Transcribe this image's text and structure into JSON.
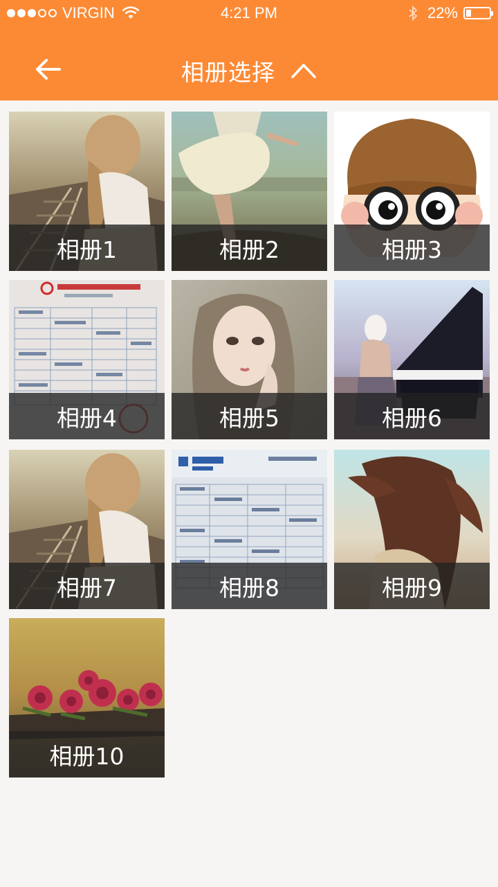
{
  "status_bar": {
    "carrier": "VIRGIN",
    "time": "4:21 PM",
    "battery_percent": "22%",
    "battery_level": 0.22,
    "signal_bars_filled": 3,
    "signal_bars_total": 5,
    "icons": [
      "signal-dots",
      "wifi-icon",
      "bluetooth-icon",
      "battery-icon"
    ]
  },
  "header": {
    "title": "相册选择",
    "back_icon": "arrow-left-icon",
    "toggle_icon": "chevron-up-icon",
    "color": "#fc8a35"
  },
  "albums": [
    {
      "label": "相册1"
    },
    {
      "label": "相册2"
    },
    {
      "label": "相册3"
    },
    {
      "label": "相册4"
    },
    {
      "label": "相册5"
    },
    {
      "label": "相册6"
    },
    {
      "label": "相册7"
    },
    {
      "label": "相册8"
    },
    {
      "label": "相册9"
    },
    {
      "label": "相册10"
    }
  ]
}
